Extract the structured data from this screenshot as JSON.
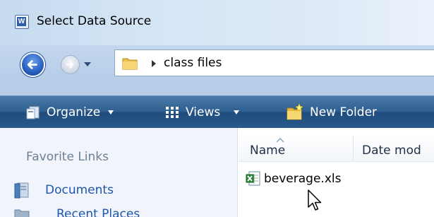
{
  "window": {
    "title": "Select Data Source"
  },
  "navigation": {
    "back_icon": "back-arrow-icon",
    "forward_icon": "forward-arrow-icon",
    "address": {
      "folder_icon": "folder-icon",
      "path": "class files"
    }
  },
  "toolbar": {
    "organize_label": "Organize",
    "views_label": "Views",
    "new_folder_label": "New Folder"
  },
  "nav_pane": {
    "section_label": "Favorite Links",
    "items": [
      {
        "label": "Documents",
        "icon": "documents-icon"
      },
      {
        "label": "Recent Places",
        "icon": "recent-places-icon"
      }
    ]
  },
  "file_list": {
    "columns": [
      "Name",
      "Date mod"
    ],
    "files": [
      {
        "name": "beverage.xls",
        "icon": "excel-file-icon"
      }
    ]
  },
  "colors": {
    "toolbar": "#2f5f8f",
    "link": "#1e56a8",
    "section_label": "#6d7f93"
  }
}
